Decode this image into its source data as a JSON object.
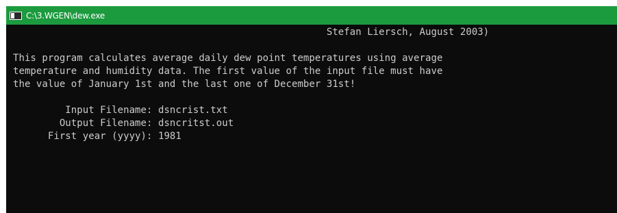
{
  "window": {
    "title": "C:\\3.WGEN\\dew.exe",
    "icon": "console-app-icon",
    "titlebar_color": "#1c9a3e",
    "console_bg": "#0c0c0c",
    "text_color": "#cccccc"
  },
  "console": {
    "lines": [
      "                                                      Stefan Liersch, August 2003)",
      "This program calculates average daily dew point temperatures using average",
      "temperature and humidity data. The first value of the input file must have",
      "the value of January 1st and the last one of December 31st!",
      "         Input Filename: dsncrist.txt",
      "        Output Filename: dsncritst.out",
      "      First year (yyyy): 1981"
    ]
  }
}
